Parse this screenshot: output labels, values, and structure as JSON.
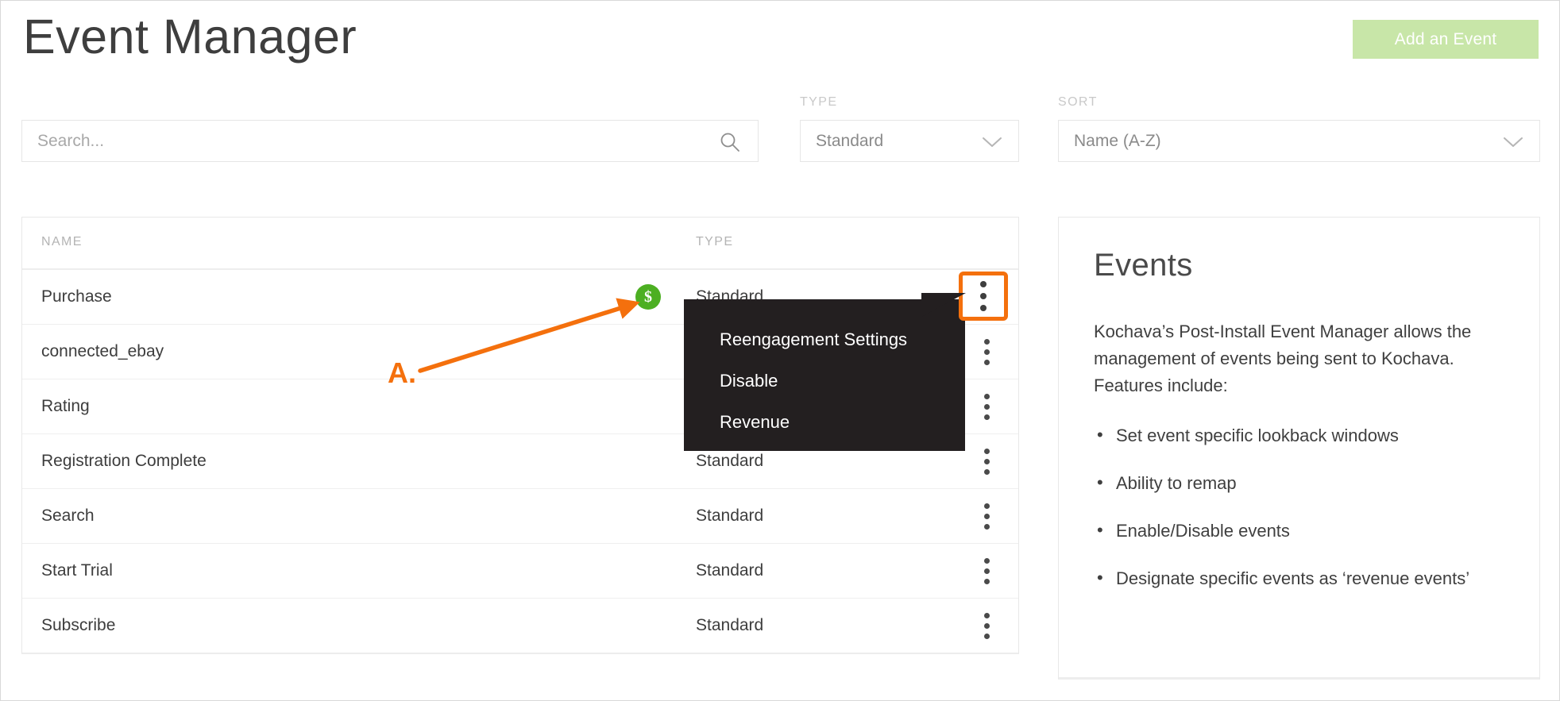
{
  "header": {
    "title": "Event Manager",
    "add_event_label": "Add an Event"
  },
  "filters": {
    "search_placeholder": "Search...",
    "search_value": "",
    "search_icon": "search-icon",
    "type_label": "TYPE",
    "type_value": "Standard",
    "type_options": [
      "Standard"
    ],
    "sort_label": "SORT",
    "sort_value": "Name (A-Z)",
    "sort_options": [
      "Name (A-Z)"
    ],
    "chevron_icon": "chevron-down-icon"
  },
  "table": {
    "columns": [
      "NAME",
      "TYPE"
    ],
    "rows": [
      {
        "name": "Purchase",
        "type": "Standard",
        "revenue_badge": "$"
      },
      {
        "name": "connected_ebay",
        "type": "",
        "revenue_badge": ""
      },
      {
        "name": "Rating",
        "type": "",
        "revenue_badge": ""
      },
      {
        "name": "Registration Complete",
        "type": "Standard",
        "revenue_badge": ""
      },
      {
        "name": "Search",
        "type": "Standard",
        "revenue_badge": ""
      },
      {
        "name": "Start Trial",
        "type": "Standard",
        "revenue_badge": ""
      },
      {
        "name": "Subscribe",
        "type": "Standard",
        "revenue_badge": ""
      }
    ],
    "row_menu_icon": "kebab-menu-icon"
  },
  "context_menu": {
    "items": [
      "Reengagement Settings",
      "Disable",
      "Revenue"
    ]
  },
  "annotation": {
    "label": "A.",
    "color": "#f4700d",
    "target": "revenue-badge"
  },
  "info_panel": {
    "title": "Events",
    "paragraph": "Kochava’s Post-Install Event Manager allows the management of events being sent to Kochava. Features include:",
    "bullets": [
      "Set event specific lookback windows",
      "Ability to remap",
      "Enable/Disable events",
      "Designate specific events as ‘revenue events’"
    ]
  },
  "colors": {
    "accent_green": "#c8e6a8",
    "revenue_green": "#4caf22",
    "annotation_orange": "#f4700d",
    "menu_dark": "#231f20"
  }
}
